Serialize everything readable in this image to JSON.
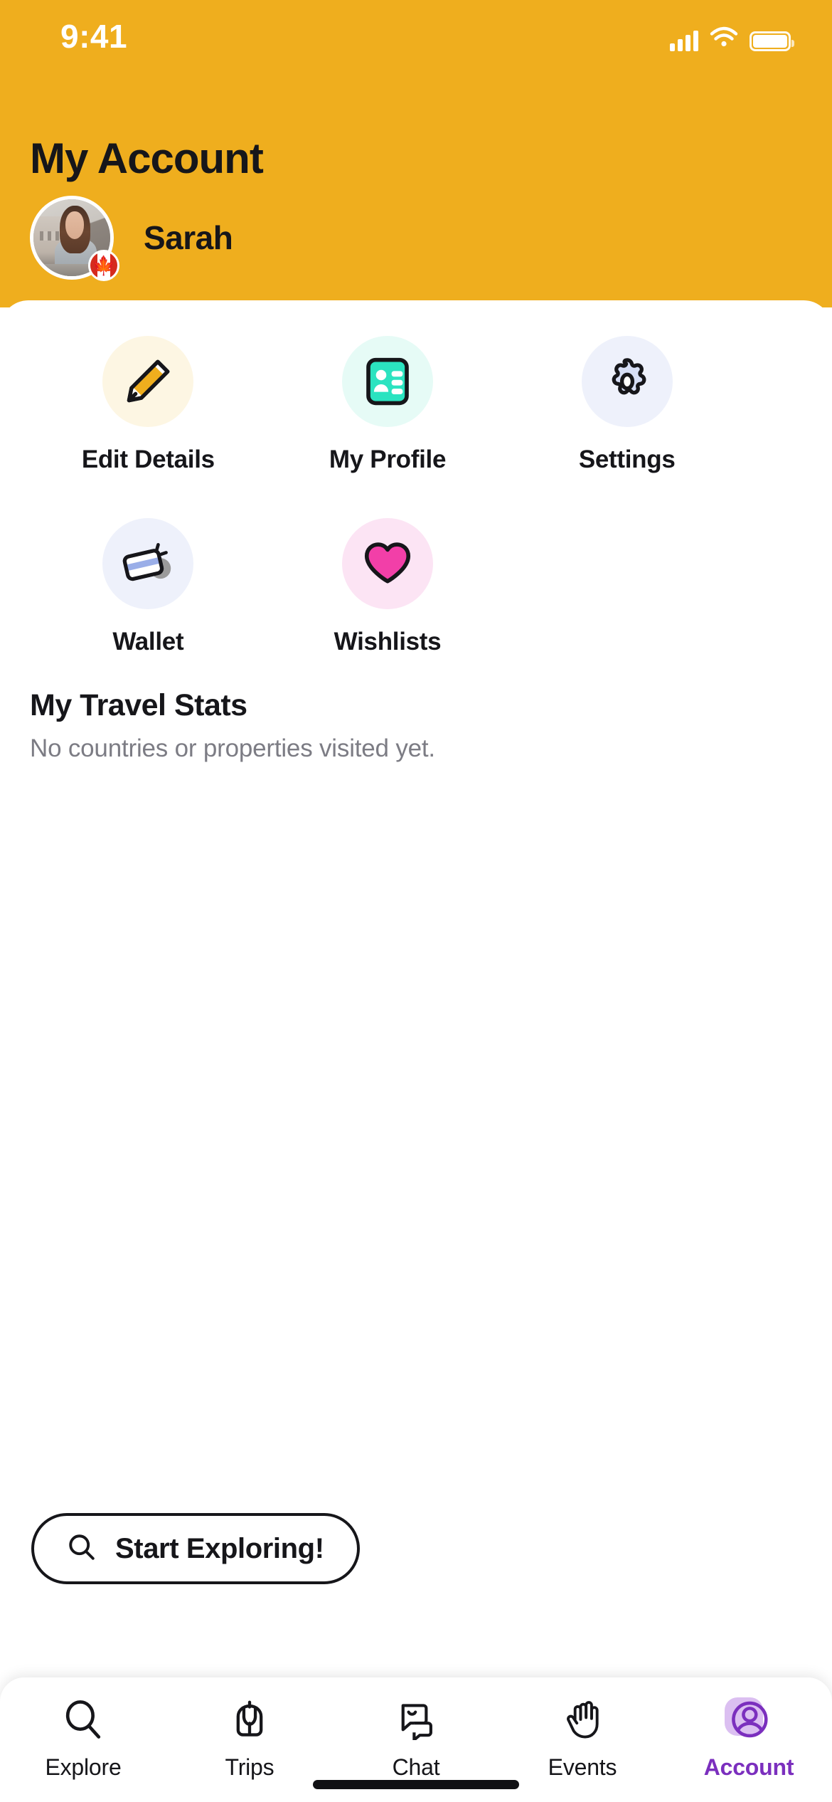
{
  "status_bar": {
    "time": "9:41",
    "cellular_icon": "signal-bars-icon",
    "wifi_icon": "wifi-icon",
    "battery_icon": "battery-icon"
  },
  "header": {
    "title": "My Account",
    "user_name": "Sarah",
    "avatar_name": "user-avatar",
    "country_badge": "canada-flag-badge",
    "background_color": "#EFAE1E",
    "title_color": "#16161A"
  },
  "actions": [
    {
      "label": "Edit Details",
      "icon": "pencil-icon",
      "circle_color": "#FDF6E3",
      "accent": "#EFAE1E"
    },
    {
      "label": "My Profile",
      "icon": "id-card-icon",
      "circle_color": "#E6FBF6",
      "accent": "#2BE3C0"
    },
    {
      "label": "Settings",
      "icon": "gear-icon",
      "circle_color": "#EEF1FB",
      "accent": "#D6DEF5"
    },
    {
      "label": "Wallet",
      "icon": "credit-card-icon",
      "circle_color": "#EEF1FB",
      "accent": "#9AAEE8"
    },
    {
      "label": "Wishlists",
      "icon": "heart-icon",
      "circle_color": "#FCE4F4",
      "accent": "#F23FA8"
    }
  ],
  "travel_stats": {
    "title": "My Travel Stats",
    "empty_message": "No countries or properties visited yet.",
    "cta_label": "Start Exploring!",
    "cta_icon": "search-icon"
  },
  "tab_bar": {
    "active_color": "#7B2FBE",
    "items": [
      {
        "label": "Explore",
        "icon": "search-icon",
        "active": false
      },
      {
        "label": "Trips",
        "icon": "backpack-icon",
        "active": false
      },
      {
        "label": "Chat",
        "icon": "chat-bubbles-icon",
        "active": false
      },
      {
        "label": "Events",
        "icon": "waving-hand-icon",
        "active": false
      },
      {
        "label": "Account",
        "icon": "user-circle-icon",
        "active": true
      }
    ]
  }
}
